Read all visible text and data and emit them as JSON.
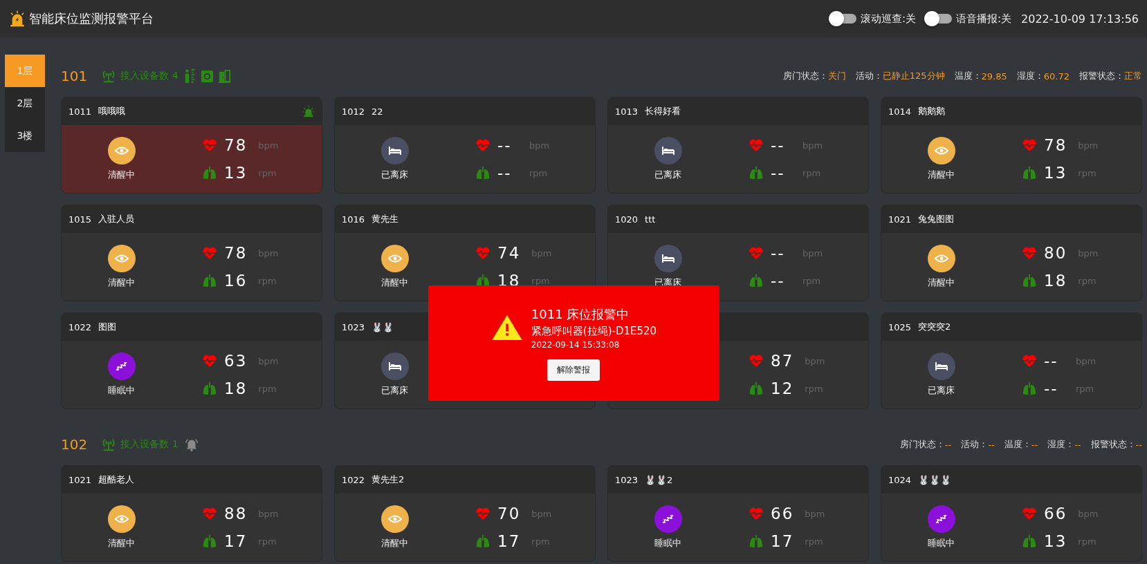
{
  "header": {
    "title": "智能床位监测报警平台",
    "toggles": [
      {
        "label": "滚动巡查:关",
        "on": false
      },
      {
        "label": "语音播报:关",
        "on": false
      }
    ],
    "datetime": "2022-10-09 17:13:56"
  },
  "floors": [
    {
      "label": "1层",
      "selected": true
    },
    {
      "label": "2层",
      "selected": false
    },
    {
      "label": "3楼",
      "selected": false
    }
  ],
  "rooms": [
    {
      "number": "101",
      "devices_label": "接入设备数 4",
      "devices": [
        {
          "kind": "radar"
        },
        {
          "kind": "sensor"
        },
        {
          "kind": "door"
        }
      ],
      "stats": [
        {
          "label": "房门状态：",
          "value": "关门"
        },
        {
          "label": "活动：",
          "value": "已静止125分钟"
        },
        {
          "label": "温度：",
          "value": "29.85"
        },
        {
          "label": "湿度：",
          "value": "60.72"
        },
        {
          "label": "报警状态：",
          "value": "正常"
        }
      ],
      "beds": [
        {
          "number": "1011",
          "name": "哦哦哦",
          "alarm": true,
          "state": {
            "kind": "awake",
            "label": "清醒中"
          },
          "heart": "78",
          "heart_unit": "bpm",
          "resp": "13",
          "resp_unit": "rpm"
        },
        {
          "number": "1012",
          "name": "22",
          "alarm": false,
          "state": {
            "kind": "away",
            "label": "已离床"
          },
          "heart": "--",
          "heart_unit": "bpm",
          "resp": "--",
          "resp_unit": "rpm"
        },
        {
          "number": "1013",
          "name": "长得好看",
          "alarm": false,
          "state": {
            "kind": "away",
            "label": "已离床"
          },
          "heart": "--",
          "heart_unit": "bpm",
          "resp": "--",
          "resp_unit": "rpm"
        },
        {
          "number": "1014",
          "name": "鹅鹅鹅",
          "alarm": false,
          "state": {
            "kind": "awake",
            "label": "清醒中"
          },
          "heart": "78",
          "heart_unit": "bpm",
          "resp": "13",
          "resp_unit": "rpm"
        },
        {
          "number": "1015",
          "name": "入驻人员",
          "alarm": false,
          "state": {
            "kind": "awake",
            "label": "清醒中"
          },
          "heart": "78",
          "heart_unit": "bpm",
          "resp": "16",
          "resp_unit": "rpm"
        },
        {
          "number": "1016",
          "name": "黄先生",
          "alarm": false,
          "state": {
            "kind": "awake",
            "label": "清醒中"
          },
          "heart": "74",
          "heart_unit": "bpm",
          "resp": "18",
          "resp_unit": "rpm"
        },
        {
          "number": "1020",
          "name": "ttt",
          "alarm": false,
          "state": {
            "kind": "away",
            "label": "已离床"
          },
          "heart": "--",
          "heart_unit": "bpm",
          "resp": "--",
          "resp_unit": "rpm"
        },
        {
          "number": "1021",
          "name": "兔兔图图",
          "alarm": false,
          "state": {
            "kind": "awake",
            "label": "清醒中"
          },
          "heart": "80",
          "heart_unit": "bpm",
          "resp": "18",
          "resp_unit": "rpm"
        },
        {
          "number": "1022",
          "name": "图图",
          "alarm": false,
          "state": {
            "kind": "sleep",
            "label": "睡眠中"
          },
          "heart": "63",
          "heart_unit": "bpm",
          "resp": "18",
          "resp_unit": "rpm"
        },
        {
          "number": "1023",
          "name": "🐰🐰",
          "alarm": false,
          "state": {
            "kind": "away",
            "label": "已离床"
          }
        },
        {
          "alarm": false,
          "heart": "87",
          "heart_unit": "bpm",
          "resp": "12",
          "resp_unit": "rpm"
        },
        {
          "number": "1025",
          "name": "突突突2",
          "alarm": false,
          "state": {
            "kind": "away",
            "label": "已离床"
          },
          "heart": "--",
          "heart_unit": "bpm",
          "resp": "--",
          "resp_unit": "rpm"
        }
      ]
    },
    {
      "number": "102",
      "devices_label": "接入设备数 1",
      "devices": [
        {
          "kind": "bell"
        }
      ],
      "stats": [
        {
          "label": "房门状态：",
          "value": "--"
        },
        {
          "label": "活动：",
          "value": "--"
        },
        {
          "label": "温度：",
          "value": "--"
        },
        {
          "label": "湿度：",
          "value": "--"
        },
        {
          "label": "报警状态：",
          "value": "--"
        }
      ],
      "beds": [
        {
          "number": "1021",
          "name": "超酷老人",
          "alarm": false,
          "state": {
            "kind": "awake",
            "label": "清醒中"
          },
          "heart": "88",
          "heart_unit": "bpm",
          "resp": "17",
          "resp_unit": "rpm"
        },
        {
          "number": "1022",
          "name": "黄先生2",
          "alarm": false,
          "state": {
            "kind": "awake",
            "label": "清醒中"
          },
          "heart": "70",
          "heart_unit": "bpm",
          "resp": "17",
          "resp_unit": "rpm"
        },
        {
          "number": "1023",
          "name": "🐰🐰2",
          "alarm": false,
          "state": {
            "kind": "sleep",
            "label": "睡眠中"
          },
          "heart": "66",
          "heart_unit": "bpm",
          "resp": "17",
          "resp_unit": "rpm"
        },
        {
          "number": "1024",
          "name": "🐰🐰🐰",
          "alarm": false,
          "state": {
            "kind": "sleep",
            "label": "睡眠中"
          },
          "heart": "66",
          "heart_unit": "bpm",
          "resp": "13",
          "resp_unit": "rpm"
        }
      ]
    }
  ],
  "alert": {
    "title": "1011 床位报警中",
    "device": "紧急呼叫器(拉绳)-D1E520",
    "time": "2022-09-14 15:33:08",
    "button": "解除警报"
  }
}
